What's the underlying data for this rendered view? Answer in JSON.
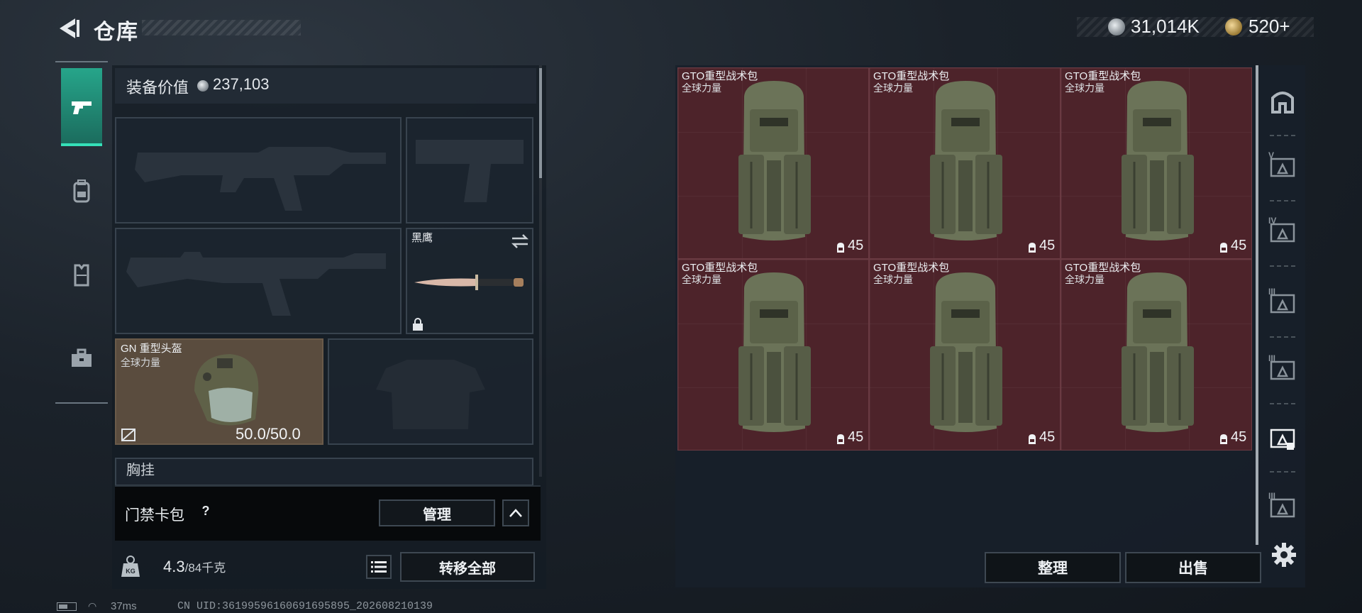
{
  "header": {
    "title": "仓库",
    "silver_amount": "31,014K",
    "gold_amount": "520+"
  },
  "left_tabs": [
    {
      "icon": "pistol-icon",
      "active": true
    },
    {
      "icon": "backpack-icon",
      "active": false
    },
    {
      "icon": "vest-icon",
      "active": false
    },
    {
      "icon": "briefcase-icon",
      "active": false
    }
  ],
  "loadout": {
    "value_label": "装备价值",
    "value_amount": "237,103",
    "melee": {
      "name": "黑鹰"
    },
    "helmet": {
      "name": "GN 重型头盔",
      "faction": "全球力量",
      "durability": "50.0/50.0"
    },
    "chest_label": "胸挂"
  },
  "keycard": {
    "label": "门禁卡包",
    "help": "?",
    "manage_label": "管理"
  },
  "weight": {
    "current": "4.3",
    "max": "/84千克"
  },
  "transfer_all_label": "转移全部",
  "stash": {
    "items": [
      {
        "name": "GTO重型战术包",
        "faction": "全球力量",
        "capacity": "45"
      },
      {
        "name": "GTO重型战术包",
        "faction": "全球力量",
        "capacity": "45"
      },
      {
        "name": "GTO重型战术包",
        "faction": "全球力量",
        "capacity": "45"
      },
      {
        "name": "GTO重型战术包",
        "faction": "全球力量",
        "capacity": "45"
      },
      {
        "name": "GTO重型战术包",
        "faction": "全球力量",
        "capacity": "45"
      },
      {
        "name": "GTO重型战术包",
        "faction": "全球力量",
        "capacity": "45"
      }
    ],
    "sort_label": "整理",
    "sell_label": "出售"
  },
  "side_tabs": [
    {
      "icon": "home-tab-icon"
    },
    {
      "icon": "stash-tab-5-icon",
      "label": "V"
    },
    {
      "icon": "stash-tab-4-icon",
      "label": "IV"
    },
    {
      "icon": "stash-tab-3a-icon",
      "label": "III"
    },
    {
      "icon": "stash-tab-3b-icon",
      "label": "III"
    },
    {
      "icon": "stash-tab-active-icon"
    },
    {
      "icon": "stash-tab-3c-icon",
      "label": "III"
    }
  ],
  "status": {
    "ping": "37ms",
    "uid": "CN UID:36199596160691695895_202608210139"
  },
  "colors": {
    "accent_teal": "#26a58a",
    "stash_red": "#4d232a",
    "bag_green": "#6b7358"
  }
}
